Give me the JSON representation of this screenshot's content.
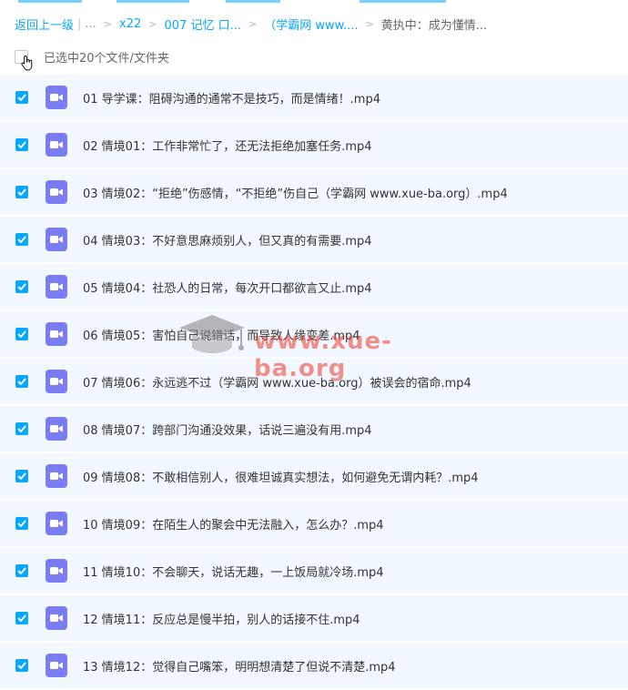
{
  "breadcrumb": {
    "back": "返回上一级",
    "ellipsis": "...",
    "items": [
      "x22",
      "007 记忆 口...",
      "（学霸网 www....",
      "黄执中：成为懂情..."
    ]
  },
  "selection": {
    "label": "已选中20个文件/文件夹"
  },
  "colors": {
    "accent": "#06a7ff",
    "row_bg": "#f2f8ff",
    "video_icon": "#7b7cf4",
    "watermark": "#ef3b2a"
  },
  "icons": {
    "file_type": "video-file-icon",
    "checkbox": "check-icon",
    "cursor": "hand-pointer-icon"
  },
  "watermark": {
    "text": "www.xue-ba.org"
  },
  "files": [
    "01 导学课：阻碍沟通的通常不是技巧，而是情绪！.mp4",
    "02 情境01：工作非常忙了，还无法拒绝加塞任务.mp4",
    "03 情境02：“拒绝”伤感情，“不拒绝”伤自己（学霸网 www.xue-ba.org）.mp4",
    "04 情境03：不好意思麻烦别人，但又真的有需要.mp4",
    "05 情境04：社恐人的日常，每次开口都欲言又止.mp4",
    "06 情境05：害怕自己说错话，而导致人缘变差.mp4",
    "07 情境06：永远逃不过（学霸网 www.xue-ba.org）被误会的宿命.mp4",
    "08 情境07：跨部门沟通没效果，话说三遍没有用.mp4",
    "09 情境08：不敢相信别人，很难坦诚真实想法，如何避免无谓内耗？.mp4",
    "10 情境09：在陌生人的聚会中无法融入，怎么办？.mp4",
    "11 情境10：不会聊天，说话无趣，一上饭局就冷场.mp4",
    "12 情境11：反应总是慢半拍，别人的话接不住.mp4",
    "13 情境12：觉得自己嘴笨，明明想清楚了但说不清楚.mp4"
  ]
}
